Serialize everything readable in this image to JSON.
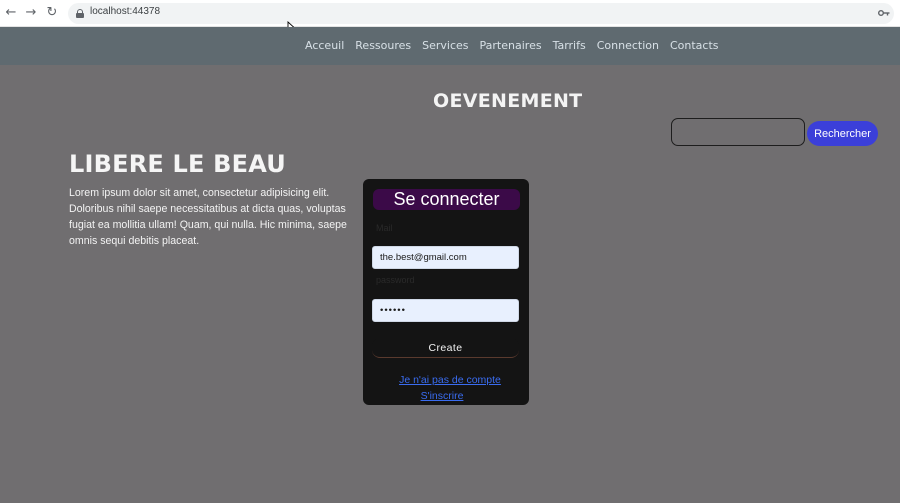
{
  "browser": {
    "url": "localhost:44378",
    "back_icon": "back-arrow-icon",
    "forward_icon": "forward-arrow-icon",
    "reload_icon": "reload-icon"
  },
  "nav": {
    "items": [
      "Acceuil",
      "Ressoures",
      "Services",
      "Partenaires",
      "Tarrifs",
      "Connection",
      "Contacts"
    ]
  },
  "page": {
    "event_title": "OEVENEMENT",
    "hero_title": "LIBERE LE BEAU",
    "hero_text": "Lorem ipsum dolor sit amet, consectetur adipisicing elit. Doloribus nihil saepe necessitatibus at dicta quas, voluptas fugiat ea mollitia ullam! Quam, qui nulla. Hic minima, saepe omnis sequi debitis placeat."
  },
  "search": {
    "placeholder": "",
    "button_label": "Rechercher"
  },
  "login": {
    "title": "Se connecter",
    "email_label": "Mail",
    "email_value": "the.best@gmail.com",
    "password_label": "password",
    "password_value": "••••••",
    "create_label": "Create",
    "no_account_link": "Je n'ai pas de compte",
    "signup_link": "S'inscrire"
  },
  "colors": {
    "page_bg": "#706e70",
    "nav_bg": "#5f6a70",
    "card_bg": "#141414",
    "title_bg": "#3b0a48",
    "search_button": "#3b3fd9",
    "link": "#3a6cf0"
  }
}
